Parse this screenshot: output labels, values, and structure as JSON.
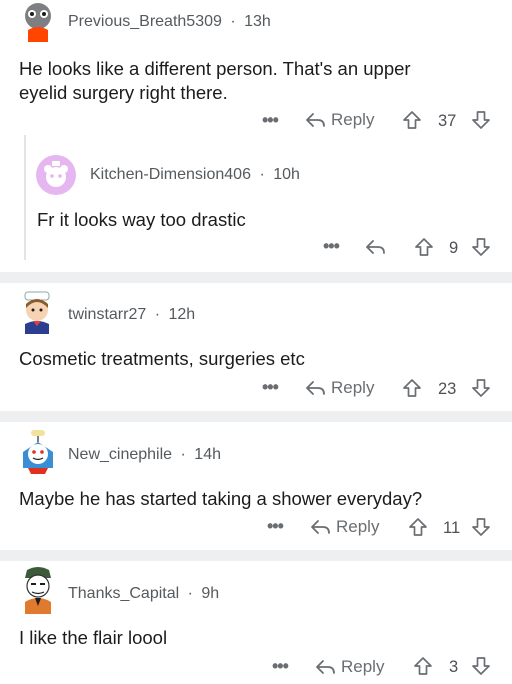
{
  "colors": {
    "separator": "#eeeff1",
    "muted": "#6a6e72",
    "text": "#1c1c1c",
    "nested_avatar_bg": "#e6b6f1"
  },
  "comments": [
    {
      "username": "Previous_Breath5309",
      "sep": "·",
      "time": "13h",
      "body_line1": "He looks like a different person. That's an upper",
      "body_line2": "eyelid surgery right there.",
      "more": "•••",
      "reply": "Reply",
      "votes": "37"
    },
    {
      "username": "Kitchen-Dimension406",
      "sep": "·",
      "time": "10h",
      "body_line1": "Fr it looks way too drastic",
      "more": "•••",
      "votes": "9"
    },
    {
      "username": "twinstarr27",
      "sep": "·",
      "time": "12h",
      "body_line1": "Cosmetic treatments, surgeries etc",
      "more": "•••",
      "reply": "Reply",
      "votes": "23"
    },
    {
      "username": "New_cinephile",
      "sep": "·",
      "time": "14h",
      "body_line1": "Maybe he has started taking a shower everyday?",
      "more": "•••",
      "reply": "Reply",
      "votes": "11"
    },
    {
      "username": "Thanks_Capital",
      "sep": "·",
      "time": "9h",
      "body_line1": "I like the flair loool",
      "more": "•••",
      "reply": "Reply",
      "votes": "3"
    }
  ],
  "icons": {
    "reply": "reply-arrow-icon",
    "upvote": "upvote-arrow-icon",
    "downvote": "downvote-arrow-icon",
    "more": "more-dots-icon"
  }
}
